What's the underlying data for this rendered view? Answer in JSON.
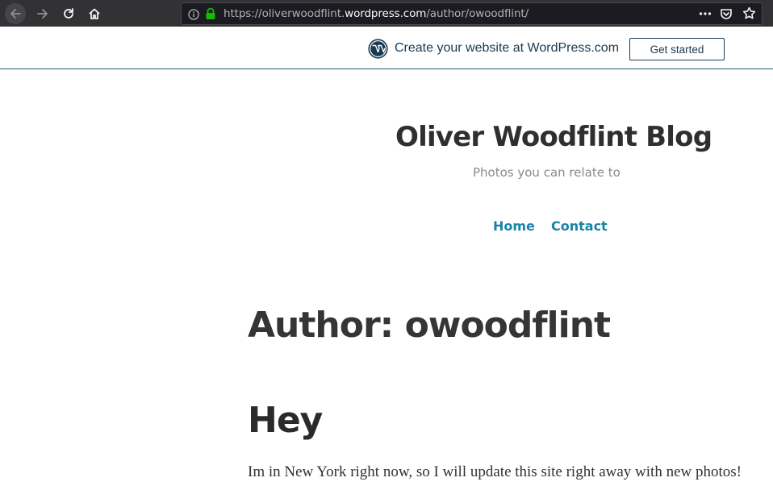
{
  "browser": {
    "url_prefix": "https://oliverwoodflint.",
    "url_domain": "wordpress.com",
    "url_path": "/author/owoodflint/"
  },
  "banner": {
    "text": "Create your website at WordPress.com",
    "button": "Get started"
  },
  "site": {
    "title": "Oliver Woodflint Blog",
    "description": "Photos you can relate to",
    "menu": [
      "Home",
      "Contact"
    ]
  },
  "content": {
    "archive_title": "Author: owoodflint",
    "post_title": "Hey",
    "post_excerpt": "Im in New York right now, so I will update this site right away with new photos!"
  },
  "colors": {
    "toolbar_bg": "#323234",
    "link": "#1a82a8",
    "banner_text": "#1a3a4f",
    "lock_green": "#12bc00"
  }
}
